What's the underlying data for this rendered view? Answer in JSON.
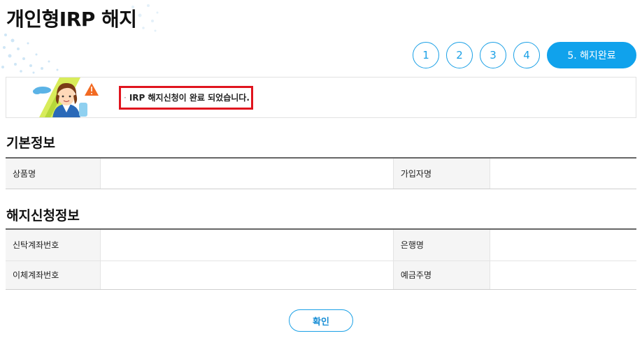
{
  "page": {
    "title": "개인형IRP 해지"
  },
  "steps": {
    "items": [
      "1",
      "2",
      "3",
      "4"
    ],
    "active_label": "5. 해지완료"
  },
  "notice": {
    "bullet": "·",
    "message": "IRP 해지신청이 완료 되었습니다."
  },
  "basic_info": {
    "title": "기본정보",
    "product_label": "상품명",
    "product_value": "",
    "subscriber_label": "가입자명",
    "subscriber_value": ""
  },
  "cancel_info": {
    "title": "해지신청정보",
    "trust_account_label": "신탁계좌번호",
    "trust_account_value": "",
    "bank_label": "은행명",
    "bank_value": "",
    "transfer_account_label": "이체계좌번호",
    "transfer_account_value": "",
    "depositor_label": "예금주명",
    "depositor_value": ""
  },
  "buttons": {
    "confirm_label": "확인"
  },
  "colors": {
    "accent": "#10a2ec",
    "highlight_border": "#e0141e"
  }
}
